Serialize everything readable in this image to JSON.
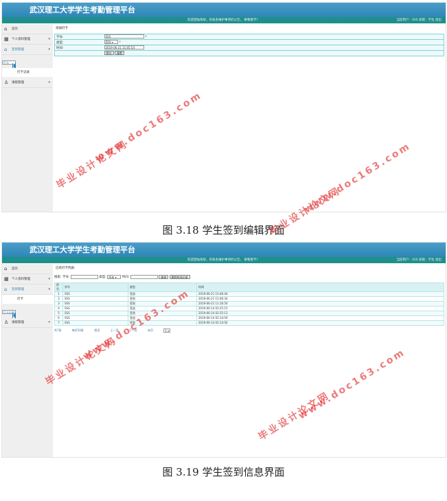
{
  "screen1": {
    "app_title": "武汉理工大学学生考勤管理平台",
    "welcome": "欢迎登陆系统，有很多维护事项的公告，  要看看不?",
    "user_info": "当前用户：SSS 权限：学生 退出",
    "sidebar": {
      "home": "首页",
      "personal": "个人资料管理",
      "checkin_mgmt": "签到管理",
      "checkin": "打卡",
      "checkin_records": "打卡记录",
      "leave_mgmt": "请假管理"
    },
    "breadcrumb": "添加打卡",
    "form": {
      "student_id_label": "学号:",
      "student_id_value": "SSS",
      "type_label": "类型:",
      "type_value": "签到 ▾",
      "time_label": "时间:",
      "time_value": "2019-06-21 11:05:54",
      "required_mark": "*",
      "submit": "提交",
      "reset": "重置"
    },
    "caption": "图 3.18 学生签到编辑界面"
  },
  "screen2": {
    "app_title": "武汉理工大学学生考勤管理平台",
    "welcome": "欢迎登陆系统，有很多维护事项的公告，  要看看不?",
    "user_info": "当前用户：SSS 权限：学生 退出",
    "sidebar": {
      "home": "首页",
      "personal": "个人资料管理",
      "checkin_mgmt": "签到管理",
      "checkin": "打卡",
      "checkin_records": "打卡记录",
      "leave_mgmt": "请假管理"
    },
    "breadcrumb": "已有打卡列表:",
    "search": {
      "label": "搜索:",
      "student_id_label": "学号:",
      "type_label": "类型:",
      "type_value": "所有 ▾",
      "time_label": "时间:",
      "search_button": "查询",
      "delete_button": "删除所选记录"
    },
    "table": {
      "headers": [
        "序号",
        "学号",
        "类型",
        "时间"
      ],
      "rows": [
        [
          "1",
          "SSS",
          "签退",
          "2019-06-21 15:46:44"
        ],
        [
          "2",
          "SSS",
          "签到",
          "2019-06-21 15:46:34"
        ],
        [
          "3",
          "SSS",
          "签到",
          "2019-06-21 11:16:50"
        ],
        [
          "4",
          "SSS",
          "签退",
          "2019-06-14 02:25:15"
        ],
        [
          "5",
          "SSS",
          "签到",
          "2019-06-14 02:25:13"
        ],
        [
          "6",
          "SSS",
          "签退",
          "2019-06-14 02:14:59"
        ],
        [
          "7",
          "SSS",
          "签到",
          "2019-06-14 02:14:56"
        ]
      ]
    },
    "pager": {
      "total": "共7条",
      "per_page": "每页10条",
      "first": "首页",
      "prev": "上一页",
      "next": "下一页",
      "last": "末页",
      "page_select": "1 ▾"
    },
    "caption": "图 3.19 学生签到信息界面"
  },
  "watermarks": [
    "毕业设计论文网",
    "www.doc163.com"
  ]
}
